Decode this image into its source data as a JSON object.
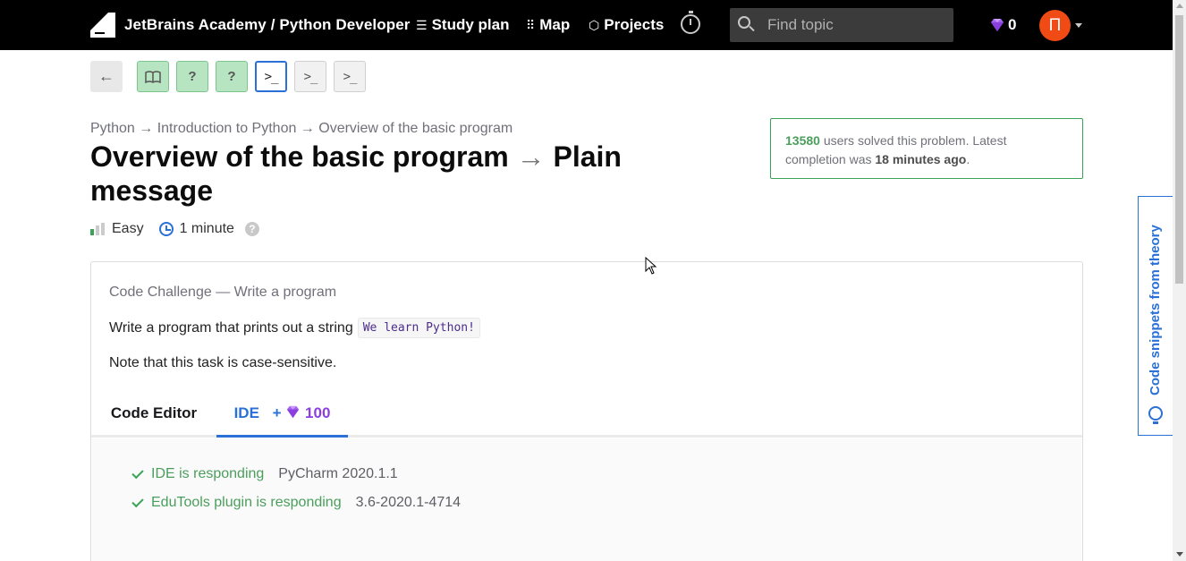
{
  "nav": {
    "brand": "JetBrains Academy / Python Developer",
    "links": [
      {
        "icon": "list-icon",
        "label": "Study plan"
      },
      {
        "icon": "grid-icon",
        "label": "Map"
      },
      {
        "icon": "cube-icon",
        "label": "Projects"
      }
    ],
    "search_placeholder": "Find topic",
    "gems": "0",
    "avatar_letter": "П",
    "colors": {
      "bg": "#000000",
      "avatar": "#f04b14",
      "gem": "#8a3fde"
    }
  },
  "steps": {
    "back": "←",
    "items": [
      {
        "type": "theory",
        "label": "📖",
        "state": "done"
      },
      {
        "type": "quiz",
        "label": "?",
        "state": "done"
      },
      {
        "type": "quiz",
        "label": "?",
        "state": "done"
      },
      {
        "type": "code",
        "label": ">_",
        "state": "current"
      },
      {
        "type": "code",
        "label": ">_",
        "state": "todo"
      },
      {
        "type": "code",
        "label": ">_",
        "state": "todo"
      }
    ]
  },
  "breadcrumbs": "Python → Introduction to Python → Overview of the basic program",
  "title": {
    "part1": "Overview of the basic program",
    "arrow": "→",
    "part2": "Plain message"
  },
  "meta": {
    "difficulty": "Easy",
    "duration": "1 minute",
    "help": "?"
  },
  "solved": {
    "count": "13580",
    "text1": " users solved this problem. Latest completion was ",
    "when": "18 minutes ago",
    "text2": "."
  },
  "challenge": {
    "kind": "Code Challenge — Write a program",
    "task_text": "Write a program that prints out a string",
    "task_code": "We learn Python!",
    "note": "Note that this task is case-sensitive."
  },
  "tabs": {
    "editor": "Code Editor",
    "ide": "IDE",
    "ide_plus": "+",
    "ide_points": "100"
  },
  "ide_status": [
    {
      "label": "IDE is responding",
      "version": "PyCharm 2020.1.1"
    },
    {
      "label": "EduTools plugin is responding",
      "version": "3.6-2020.1-4714"
    }
  ],
  "sidetab": {
    "label": "Code snippets from theory"
  }
}
